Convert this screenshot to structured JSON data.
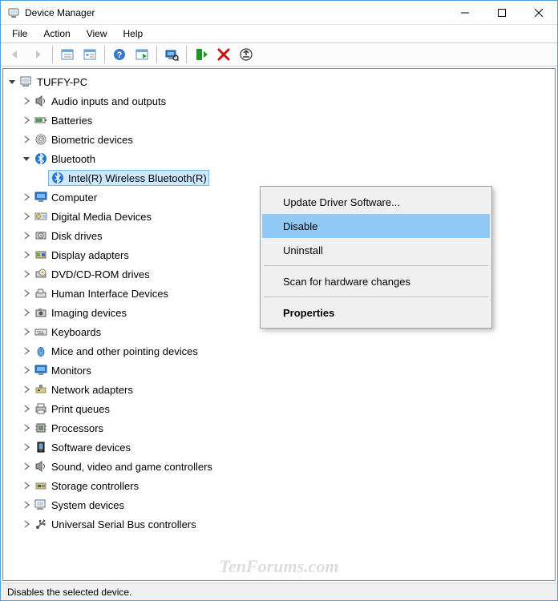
{
  "window": {
    "title": "Device Manager"
  },
  "menus": {
    "file": "File",
    "action": "Action",
    "view": "View",
    "help": "Help"
  },
  "tree": {
    "root": "TUFFY-PC",
    "items": {
      "audio": "Audio inputs and outputs",
      "batteries": "Batteries",
      "biometric": "Biometric devices",
      "bluetooth": "Bluetooth",
      "bt_device": "Intel(R) Wireless Bluetooth(R)",
      "computer": "Computer",
      "digital_media": "Digital Media Devices",
      "disk": "Disk drives",
      "display_adapters": "Display adapters",
      "dvd": "DVD/CD-ROM drives",
      "hid": "Human Interface Devices",
      "imaging": "Imaging devices",
      "keyboards": "Keyboards",
      "mice": "Mice and other pointing devices",
      "monitors": "Monitors",
      "network": "Network adapters",
      "printq": "Print queues",
      "processors": "Processors",
      "software": "Software devices",
      "sound": "Sound, video and game controllers",
      "storage": "Storage controllers",
      "system": "System devices",
      "usb": "Universal Serial Bus controllers"
    }
  },
  "context_menu": {
    "update_driver": "Update Driver Software...",
    "disable": "Disable",
    "uninstall": "Uninstall",
    "scan": "Scan for hardware changes",
    "properties": "Properties"
  },
  "status": "Disables the selected device.",
  "watermark": "TenForums.com"
}
